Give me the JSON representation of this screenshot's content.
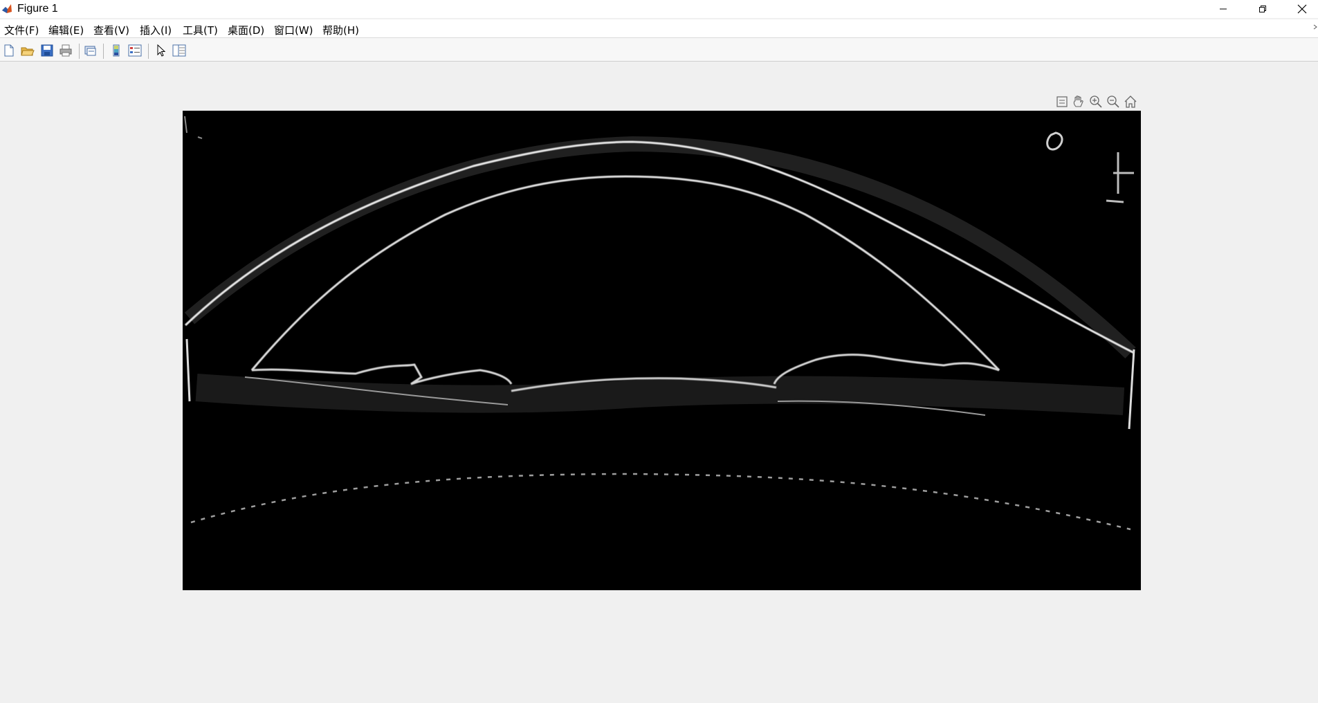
{
  "window": {
    "title": "Figure 1"
  },
  "menu": [
    {
      "label": "文件(F)"
    },
    {
      "label": "编辑(E)"
    },
    {
      "label": "查看(V)"
    },
    {
      "label": "插入(I)"
    },
    {
      "label": "工具(T)"
    },
    {
      "label": "桌面(D)"
    },
    {
      "label": "窗口(W)"
    },
    {
      "label": "帮助(H)"
    }
  ],
  "toolbar": {
    "icons": [
      "new-figure-icon",
      "open-file-icon",
      "save-icon",
      "print-icon",
      "link-plot-icon",
      "insert-colorbar-icon",
      "insert-legend-icon",
      "edit-plot-arrow-icon",
      "property-inspector-icon"
    ]
  },
  "axes_toolbar": {
    "icons": [
      "export-icon",
      "pan-hand-icon",
      "zoom-in-icon",
      "zoom-out-icon",
      "home-restore-icon"
    ]
  },
  "image": {
    "description_color": "#000000",
    "edge_color": "#ffffff"
  },
  "colors": {
    "background": "#f0f0f0",
    "titlebar": "#ffffff",
    "toolbar": "#f7f7f7"
  }
}
